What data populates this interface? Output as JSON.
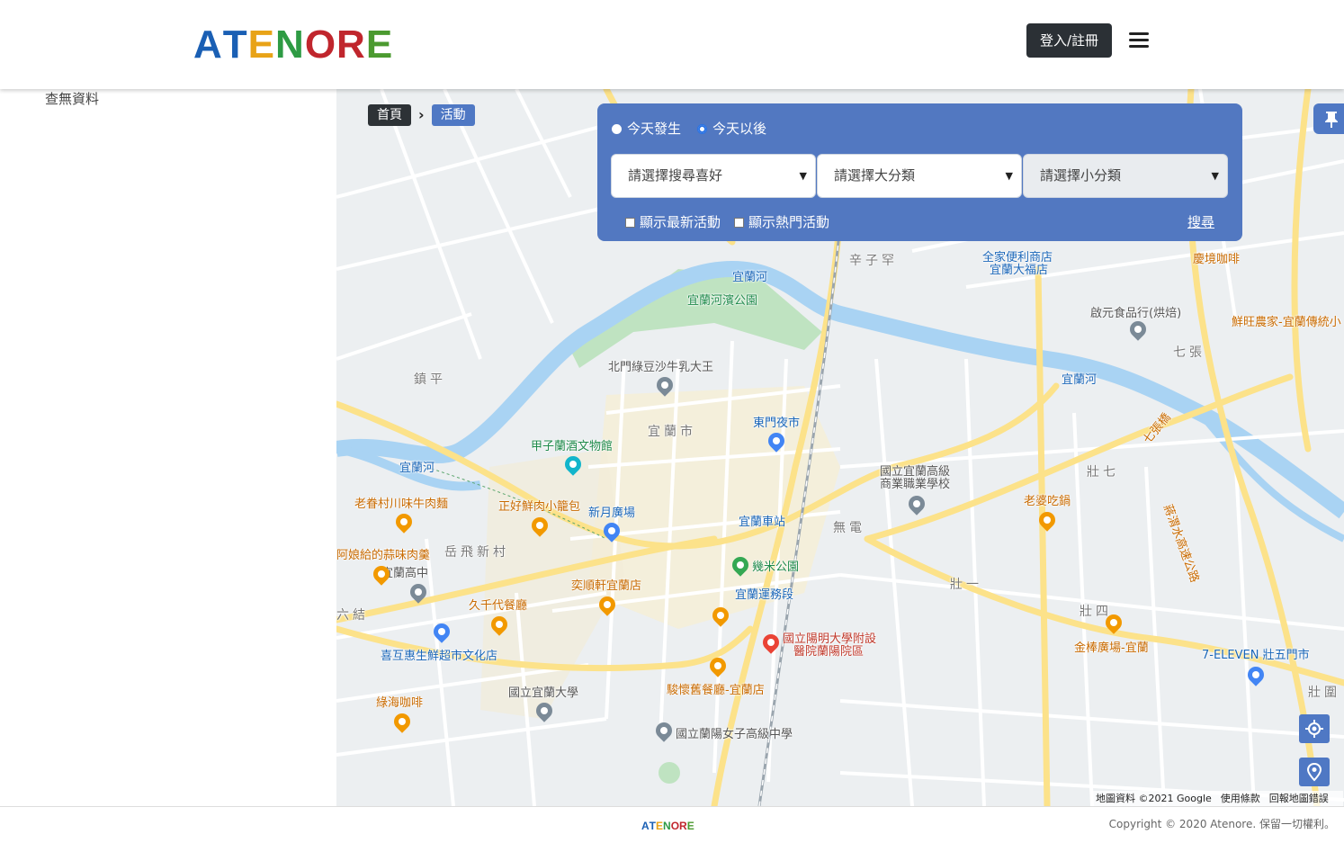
{
  "header": {
    "logo_letters": [
      "A",
      "T",
      "E",
      "N",
      "O",
      "R",
      "E"
    ],
    "logo_colors": [
      "#1a5fb4",
      "#1a5fb4",
      "#e8a317",
      "#2e9b44",
      "#c0262d",
      "#c0262d",
      "#4b9a30"
    ],
    "login_label": "登入/註冊"
  },
  "sidebar": {
    "empty_text": "查無資料"
  },
  "breadcrumb": {
    "home": "首頁",
    "current": "活動"
  },
  "filter": {
    "radio_today": "今天發生",
    "radio_after": "今天以後",
    "select_pref": "請選擇搜尋喜好",
    "select_major": "請選擇大分類",
    "select_minor": "請選擇小分類",
    "chk_latest": "顯示最新活動",
    "chk_hot": "顯示熱門活動",
    "search_label": "搜尋"
  },
  "map": {
    "places": {
      "p1": "全家便利商店",
      "p2": "宜蘭大福店",
      "p3": "慶境咖啡",
      "p4": "宜蘭河濱公園",
      "p5": "啟元食品行(烘焙)",
      "p6": "鮮旺農家-宜蘭傳統小",
      "p7": "北門綠豆沙牛乳大王",
      "p8": "東門夜市",
      "p9": "甲子蘭酒文物館",
      "p10": "國立宜蘭高級",
      "p11": "商業職業學校",
      "p12": "老婆吃鍋",
      "p13": "老眷村川味牛肉麵",
      "p14": "正好鮮肉小籠包",
      "p15": "新月廣場",
      "p16": "宜蘭車站",
      "p17": "阿娘給的蒜味肉羹",
      "p18": "宜蘭高中",
      "p19": "幾米公園",
      "p20": "宜蘭運務段",
      "p21": "奕順軒宜蘭店",
      "p22": "久千代餐廳",
      "p23": "國立陽明大學附設",
      "p24": "醫院蘭陽院區",
      "p25": "金棒廣場-宜蘭",
      "p26": "7-ELEVEN 壯五門市",
      "p27": "喜互惠生鮮超市文化店",
      "p28": "國立宜蘭大學",
      "p29": "駿懷舊餐廳-宜蘭店",
      "p30": "綠海咖啡",
      "p31": "國立蘭陽女子高級中學"
    },
    "areas": {
      "a1": "辛子罕",
      "a2": "鎮平",
      "a3": "宜蘭市",
      "a4": "岳飛新村",
      "a5": "無電",
      "a6": "壯七",
      "a7": "壯一",
      "a8": "壯四",
      "a9": "七張",
      "a10": "六結",
      "a11": "宜蘭河",
      "a12": "宜蘭河",
      "a13": "宜蘭河",
      "a14": "七張橋",
      "a15": "蔣渭水高速公路",
      "a16": "壯圍"
    },
    "attribution": [
      "地圖資料 ©2021 Google",
      "使用條款",
      "回報地圖錯誤"
    ]
  },
  "footer": {
    "logo_letters": [
      "A",
      "T",
      "E",
      "N",
      "O",
      "R",
      "E"
    ],
    "copyright": "Copyright © 2020 Atenore. 保留一切權利。"
  }
}
